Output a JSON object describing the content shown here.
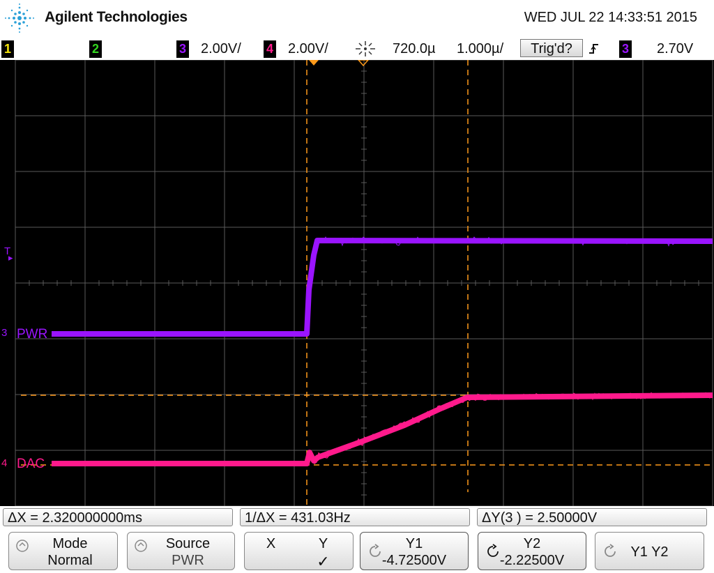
{
  "header": {
    "brand": "Agilent Technologies",
    "datetime": "WED JUL 22 14:33:51 2015"
  },
  "status": {
    "ch1": "1",
    "ch2": "2",
    "ch3": "3",
    "ch3_scale": "2.00V/",
    "ch4": "4",
    "ch4_scale": "2.00V/",
    "time_delay": "720.0µ",
    "time_scale": "1.000µ/",
    "trig_state": "Trig'd?",
    "trig_slope_glyph": "⨍",
    "trig_source": "3",
    "trig_level": "2.70V"
  },
  "colors": {
    "ch1": "#f5e50b",
    "ch2": "#33d61f",
    "ch3": "#9a14ff",
    "ch4": "#ff1a8c",
    "cursor": "#ff9a1a",
    "grid": "#5a5a5a"
  },
  "icons": {
    "logo": "agilent-spark-logo",
    "timebase": "timebase-spark-icon",
    "slope": "rising-edge-icon"
  },
  "screen": {
    "trigger_marker": "T",
    "ch3_marker": "3",
    "ch3_label": "PWR",
    "ch4_marker": "4",
    "ch4_label": "DAC"
  },
  "measurements": {
    "dx": "ΔX = 2.320000000ms",
    "inv_dx": "1/ΔX = 431.03Hz",
    "dy": "ΔY(3 ) = 2.50000V"
  },
  "softkeys": [
    {
      "line1": "Mode",
      "line2": "Normal"
    },
    {
      "line1": "Source",
      "line2": "PWR"
    },
    {
      "line1": "X",
      "line2": "Y",
      "line3": "✓"
    },
    {
      "line1": "Y1",
      "line2": "-4.72500V"
    },
    {
      "line1": "Y2",
      "line2": "-2.22500V"
    },
    {
      "line1": "Y1 Y2"
    }
  ]
}
